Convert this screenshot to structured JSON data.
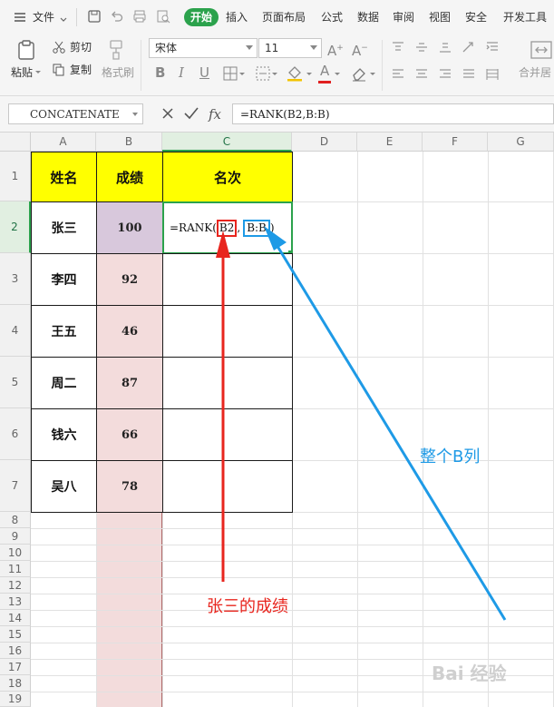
{
  "menubar": {
    "file": "文件",
    "tabs": [
      "开始",
      "插入",
      "页面布局",
      "公式",
      "数据",
      "审阅",
      "视图",
      "安全",
      "开发工具"
    ],
    "active_tab": "开始"
  },
  "ribbon": {
    "paste": "粘贴",
    "cut": "剪切",
    "copy": "复制",
    "format_painter": "格式刷",
    "font_name": "宋体",
    "font_size": "11",
    "merge_center": "合并居"
  },
  "formula_bar": {
    "name_box": "CONCATENATE",
    "fx": "fx",
    "formula": "=RANK(B2,B:B)"
  },
  "grid": {
    "columns": [
      "A",
      "B",
      "C",
      "D",
      "E",
      "F",
      "G"
    ],
    "rows": [
      "1",
      "2",
      "3",
      "4",
      "5",
      "6",
      "7",
      "8",
      "9",
      "10",
      "11",
      "12",
      "13",
      "14",
      "15",
      "16",
      "17",
      "18",
      "19"
    ],
    "headers": [
      "姓名",
      "成绩",
      "名次"
    ],
    "names": [
      "张三",
      "李四",
      "王五",
      "周二",
      "钱六",
      "吴八"
    ],
    "scores": [
      "100",
      "92",
      "46",
      "87",
      "66",
      "78"
    ],
    "active_cell_formula": {
      "prefix": "=RANK(",
      "ref1": "B2",
      "comma": ",",
      "ref2": "B:B",
      "suffix": ")"
    }
  },
  "annotations": {
    "red_label": "张三的成绩",
    "blue_label": "整个B列",
    "red_color": "#e8251e",
    "blue_color": "#1e9ae6"
  },
  "watermark": "Bai 经验"
}
